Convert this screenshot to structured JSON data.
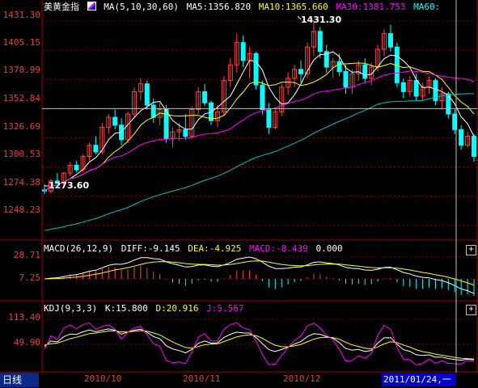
{
  "main_header": {
    "title": "美黄金指",
    "ma_label": "MA(5,10,30,60)",
    "ma5": "MA5:1356.820",
    "ma10": "MA10:1365.660",
    "ma30": "MA30:1381.753",
    "ma60": "MA60:"
  },
  "macd_header": {
    "label": "MACD(26,12,9)",
    "diff": "DIFF:-9.145",
    "dea": "DEA:-4.925",
    "macd": "MACD:-8.439",
    "extra": "0.000"
  },
  "kdj_header": {
    "label": "KDJ(9,3,3)",
    "k": "K:15.800",
    "d": "D:20.916",
    "j": "J:5.567"
  },
  "price_axis": [
    "1431.30",
    "1405.15",
    "1378.99",
    "1352.84",
    "1326.69",
    "1300.53",
    "1274.38",
    "1248.23"
  ],
  "macd_axis": [
    "28.71",
    "7.25"
  ],
  "kdj_axis": [
    "113.40",
    "49.90"
  ],
  "x_axis": [
    "2010/10",
    "2010/11",
    "2010/12"
  ],
  "annotations": {
    "high": "1431.30",
    "low": "1273.60"
  },
  "footer": {
    "tab": "日线",
    "cursor_date": "2011/01/24,一"
  },
  "colors": {
    "up": "#ff4040",
    "down": "#00ffff",
    "ma5": "#ffffff",
    "ma10": "#ffff00",
    "ma30": "#ff00ff",
    "ma60": "#00c0c0",
    "grid": "#800000",
    "axis_text": "#e04040"
  },
  "icons": [
    "plus-icon"
  ],
  "chart_data": {
    "type": "candlestick",
    "price_range": [
      1235,
      1440
    ],
    "highest": 1431.3,
    "lowest": 1273.6,
    "candles": [
      [
        1280,
        1285,
        1276,
        1279
      ],
      [
        1279,
        1290,
        1277,
        1288
      ],
      [
        1288,
        1295,
        1285,
        1286
      ],
      [
        1286,
        1296,
        1284,
        1295
      ],
      [
        1295,
        1305,
        1292,
        1302
      ],
      [
        1302,
        1306,
        1296,
        1298
      ],
      [
        1298,
        1312,
        1296,
        1310
      ],
      [
        1310,
        1322,
        1306,
        1320
      ],
      [
        1320,
        1328,
        1312,
        1314
      ],
      [
        1314,
        1340,
        1312,
        1336
      ],
      [
        1336,
        1348,
        1330,
        1345
      ],
      [
        1345,
        1352,
        1334,
        1338
      ],
      [
        1338,
        1344,
        1320,
        1325
      ],
      [
        1325,
        1350,
        1322,
        1348
      ],
      [
        1348,
        1372,
        1344,
        1368
      ],
      [
        1368,
        1380,
        1360,
        1375
      ],
      [
        1375,
        1378,
        1352,
        1356
      ],
      [
        1356,
        1362,
        1340,
        1345
      ],
      [
        1345,
        1358,
        1338,
        1352
      ],
      [
        1352,
        1356,
        1322,
        1326
      ],
      [
        1326,
        1336,
        1318,
        1332
      ],
      [
        1332,
        1340,
        1324,
        1334
      ],
      [
        1334,
        1348,
        1325,
        1328
      ],
      [
        1328,
        1355,
        1326,
        1352
      ],
      [
        1352,
        1372,
        1348,
        1368
      ],
      [
        1368,
        1375,
        1355,
        1358
      ],
      [
        1358,
        1360,
        1338,
        1342
      ],
      [
        1342,
        1356,
        1336,
        1350
      ],
      [
        1350,
        1382,
        1346,
        1378
      ],
      [
        1378,
        1398,
        1372,
        1392
      ],
      [
        1392,
        1420,
        1385,
        1412
      ],
      [
        1412,
        1418,
        1390,
        1396
      ],
      [
        1396,
        1408,
        1380,
        1402
      ],
      [
        1402,
        1404,
        1370,
        1374
      ],
      [
        1374,
        1378,
        1348,
        1352
      ],
      [
        1352,
        1358,
        1330,
        1336
      ],
      [
        1336,
        1354,
        1334,
        1350
      ],
      [
        1350,
        1375,
        1346,
        1372
      ],
      [
        1372,
        1385,
        1365,
        1380
      ],
      [
        1380,
        1392,
        1372,
        1388
      ],
      [
        1388,
        1396,
        1376,
        1384
      ],
      [
        1384,
        1412,
        1380,
        1408
      ],
      [
        1408,
        1431.3,
        1400,
        1422
      ],
      [
        1422,
        1426,
        1398,
        1404
      ],
      [
        1404,
        1410,
        1385,
        1390
      ],
      [
        1390,
        1398,
        1380,
        1395
      ],
      [
        1395,
        1402,
        1382,
        1386
      ],
      [
        1386,
        1392,
        1366,
        1372
      ],
      [
        1372,
        1388,
        1366,
        1384
      ],
      [
        1384,
        1396,
        1378,
        1392
      ],
      [
        1392,
        1398,
        1376,
        1380
      ],
      [
        1380,
        1394,
        1374,
        1390
      ],
      [
        1390,
        1410,
        1386,
        1406
      ],
      [
        1406,
        1424,
        1400,
        1420
      ],
      [
        1420,
        1428,
        1404,
        1408
      ],
      [
        1408,
        1412,
        1372,
        1376
      ],
      [
        1376,
        1380,
        1362,
        1368
      ],
      [
        1368,
        1382,
        1364,
        1378
      ],
      [
        1378,
        1384,
        1360,
        1364
      ],
      [
        1364,
        1376,
        1360,
        1372
      ],
      [
        1372,
        1382,
        1366,
        1378
      ],
      [
        1378,
        1380,
        1356,
        1360
      ],
      [
        1360,
        1372,
        1352,
        1366
      ],
      [
        1366,
        1368,
        1344,
        1348
      ],
      [
        1348,
        1352,
        1330,
        1334
      ],
      [
        1334,
        1338,
        1316,
        1320
      ],
      [
        1320,
        1332,
        1318,
        1328
      ],
      [
        1328,
        1330,
        1305,
        1310
      ]
    ]
  }
}
